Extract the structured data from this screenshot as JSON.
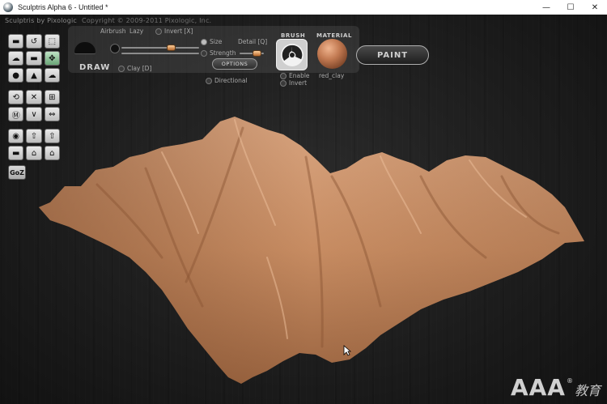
{
  "window": {
    "title": "Sculptris Alpha 6 - Untitled *",
    "minimize": "—",
    "maximize": "☐",
    "close": "✕"
  },
  "app": {
    "copyright_name": "Sculptris by Pixologic",
    "copyright_text": "Copyright © 2009-2011 Pixologic, Inc."
  },
  "toolbar": {
    "tools": [
      [
        "▬",
        "↺",
        "⬚"
      ],
      [
        "☁",
        "▬",
        "✥"
      ],
      [
        "●",
        "▲",
        "☁"
      ],
      [
        "⟲",
        "✕",
        "⊞"
      ],
      [
        "Ⓜ",
        "∨",
        "⇔"
      ],
      [
        "◉",
        "⇧",
        "⇧"
      ],
      [
        "▬",
        "⌂",
        "⌂"
      ]
    ],
    "goz_label": "GoZ"
  },
  "brush": {
    "mode_label": "DRAW",
    "airbrush_label": "Airbrush",
    "lazy_label": "Lazy",
    "invert_label": "Invert [X]",
    "size_label": "Size",
    "detail_label": "Detail [Q]",
    "strength_label": "Strength",
    "options_label": "OPTIONS",
    "clay_label": "Clay [D]",
    "directional_label": "Directional"
  },
  "brush_section": {
    "header": "BRUSH",
    "enable_label": "Enable",
    "invert_label": "Invert"
  },
  "material_section": {
    "header": "MATERIAL",
    "material_name": "red_clay"
  },
  "paint_button": "PAINT",
  "watermark": {
    "main": "AAA",
    "reg": "®",
    "sub": "教育"
  },
  "colors": {
    "clay": "#c99068",
    "background": "#1d1d1d",
    "accent_green": "#6aa577"
  }
}
